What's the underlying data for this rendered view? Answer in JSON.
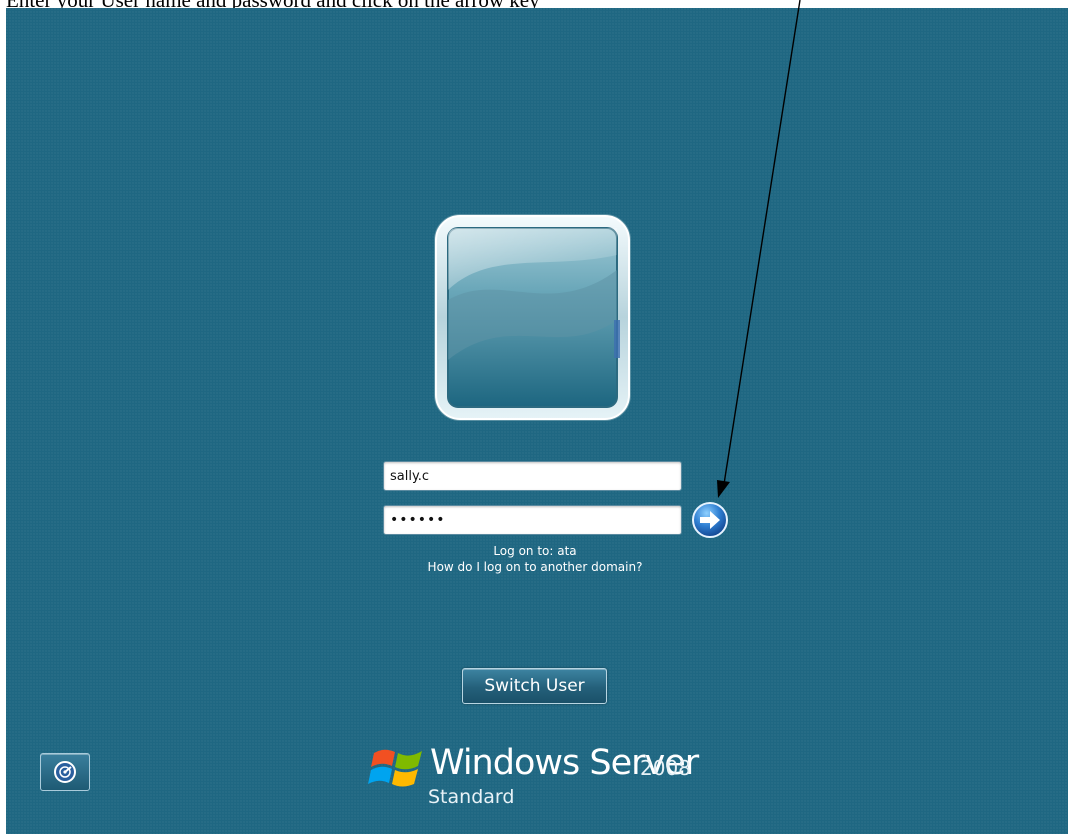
{
  "caption": {
    "text": "Enter your User name and password and click on the arrow key"
  },
  "login": {
    "username_value": "sally.c",
    "password_value": "••••••",
    "logon_to": "Log on to: ata",
    "other_domain_link": "How do I log on to another domain?",
    "switch_user_label": "Switch User"
  },
  "brand": {
    "name": "Windows Server",
    "year": "2008",
    "edition": "Standard"
  },
  "icons": {
    "submit": "arrow-right-circle-icon",
    "ease_of_access": "ease-of-access-icon",
    "logo": "windows-flag-logo"
  },
  "colors": {
    "background": "#1f6782",
    "submit_button": "#2f7fd2",
    "text": "#ffffff"
  }
}
